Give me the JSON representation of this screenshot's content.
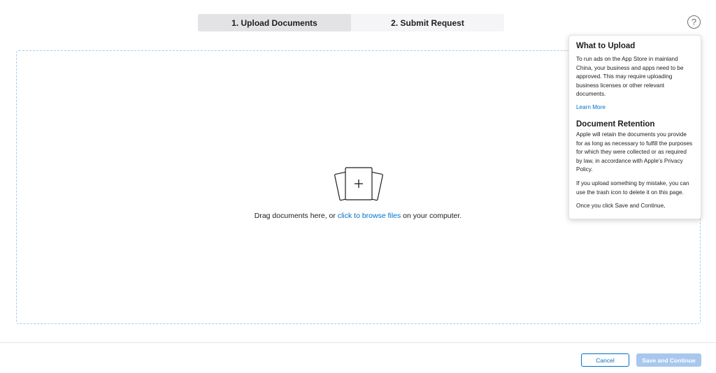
{
  "stepper": {
    "steps": [
      {
        "label": "1. Upload Documents",
        "active": true
      },
      {
        "label": "2. Submit Request",
        "active": false
      }
    ]
  },
  "help": {
    "icon": "question-circle-icon",
    "glyph": "?"
  },
  "dropzone": {
    "icon": "document-stack-plus-icon",
    "text_before": "Drag documents here, or ",
    "link": "click to browse files",
    "text_after": " on your computer."
  },
  "popover": {
    "section1_title": "What to Upload",
    "section1_text": "To run ads on the App Store in mainland China, your business and apps need to be approved. This may require uploading business licenses or other relevant documents.",
    "learn_more": "Learn More",
    "section2_title": "Document Retention",
    "section2_text": "Apple will retain the documents you provide for as long as necessary to fulfill the purposes for which they were collected or as required by law, in accordance with Apple’s Privacy Policy.",
    "section2_text2": "If you upload something by mistake, you can use the trash icon to delete it on this page.",
    "section2_text3": "Once you click Save and Continue,"
  },
  "footer": {
    "cancel_label": "Cancel",
    "save_label": "Save and Continue"
  },
  "colors": {
    "accent": "#0070c9",
    "dropzone_border": "#a9c9ef",
    "save_disabled": "#a8c7ef"
  }
}
